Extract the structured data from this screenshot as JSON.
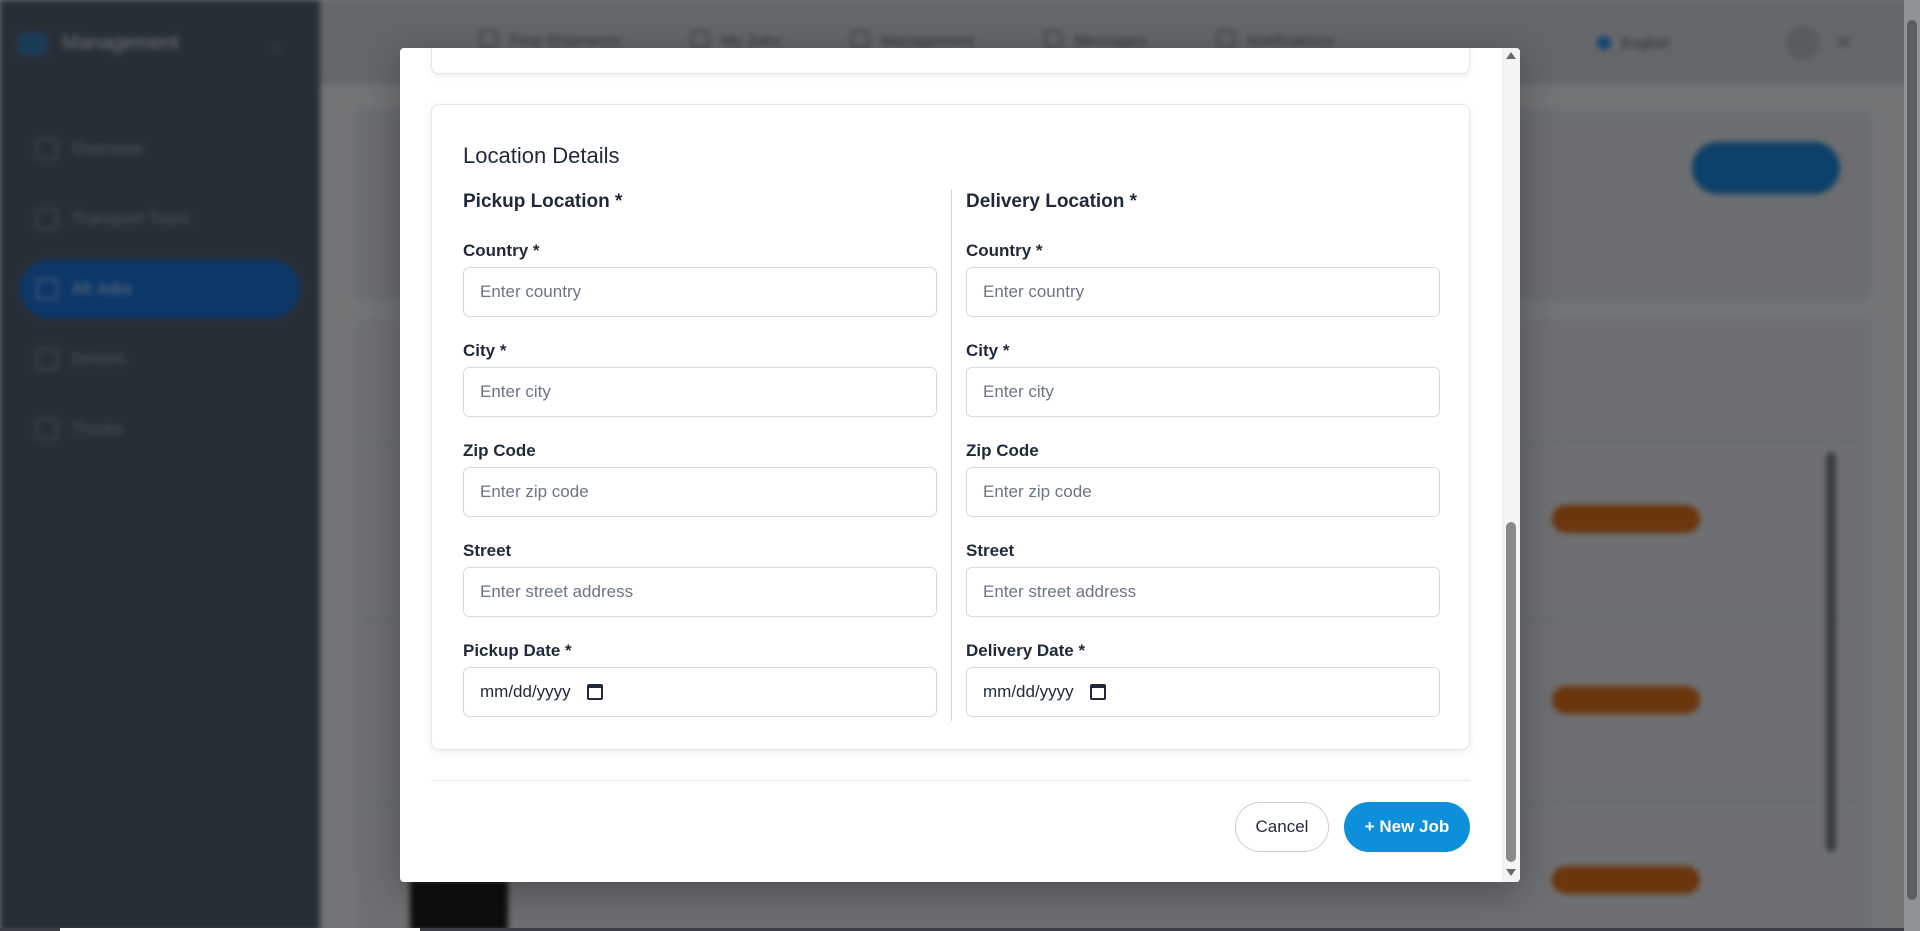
{
  "background": {
    "brand": "Management",
    "nav_items": [
      "Overview",
      "Transport Tours",
      "All Jobs",
      "Drivers",
      "Trucks"
    ],
    "active_nav": "All Jobs",
    "top_links": [
      "Find Shipments",
      "My Jobs",
      "Management",
      "Messages",
      "Notifications"
    ],
    "language": "English"
  },
  "modal": {
    "section_title": "Location Details",
    "pickup": {
      "title": "Pickup Location *",
      "country_label": "Country *",
      "country_placeholder": "Enter country",
      "city_label": "City *",
      "city_placeholder": "Enter city",
      "zip_label": "Zip Code",
      "zip_placeholder": "Enter zip code",
      "street_label": "Street",
      "street_placeholder": "Enter street address",
      "date_label": "Pickup Date *",
      "date_value": "mm/dd/yyyy"
    },
    "delivery": {
      "title": "Delivery Location *",
      "country_label": "Country *",
      "country_placeholder": "Enter country",
      "city_label": "City *",
      "city_placeholder": "Enter city",
      "zip_label": "Zip Code",
      "zip_placeholder": "Enter zip code",
      "street_label": "Street",
      "street_placeholder": "Enter street address",
      "date_label": "Delivery Date *",
      "date_value": "mm/dd/yyyy"
    },
    "cancel_label": "Cancel",
    "submit_label": "+ New Job"
  },
  "colors": {
    "primary": "#0e8fd9",
    "overlay": "rgba(0,0,0,0.45)",
    "status_pill": "#c4621a"
  },
  "icons": [
    "calendar-icon",
    "scroll-up-arrow",
    "scroll-down-arrow"
  ]
}
